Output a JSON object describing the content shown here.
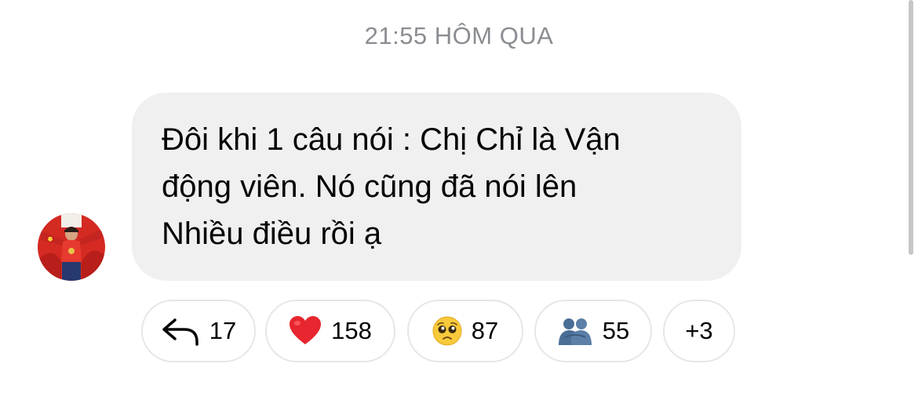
{
  "timestamp": "21:55 HÔM QUA",
  "message": {
    "lines": [
      "Đôi khi 1 câu nói : Chị Chỉ là Vận",
      "động viên. Nó cũng đã nói lên",
      "Nhiều điều rồi ạ"
    ],
    "bubble_color": "#f0f0f0"
  },
  "avatar": {
    "icon": "user-avatar-flag"
  },
  "reactions": [
    {
      "icon": "reply-arrow-icon",
      "count": "17"
    },
    {
      "icon": "heart-icon",
      "count": "158",
      "color": "#e8262f"
    },
    {
      "icon": "pleading-face-icon",
      "count": "87"
    },
    {
      "icon": "hug-icon",
      "count": "55"
    },
    {
      "icon": "more-reactions",
      "count": "+3"
    }
  ],
  "colors": {
    "timestamp": "#8a8d91",
    "text": "#050505",
    "pill_border": "#e6e6e6"
  }
}
